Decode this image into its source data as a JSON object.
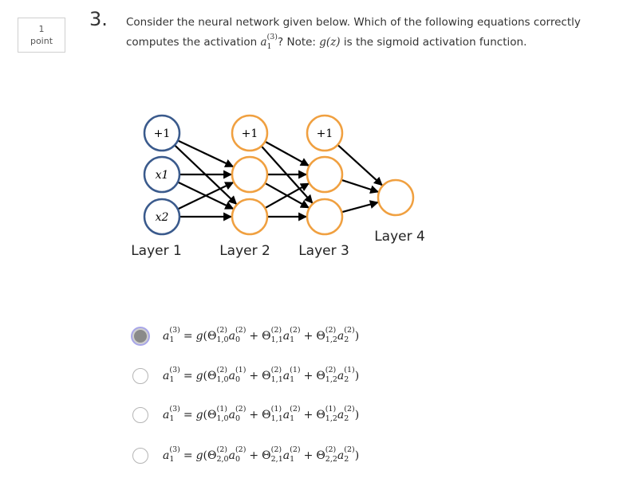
{
  "points": {
    "value": "1",
    "label": "point"
  },
  "question": {
    "number": "3.",
    "text_before": "Consider the neural network given below. Which of the following equations correctly computes the activation ",
    "activation_var": "a",
    "activation_sup": "(3)",
    "activation_sub": "1",
    "text_after": "? Note: ",
    "note_func": "g(z)",
    "note_rest": " is the sigmoid activation function."
  },
  "network": {
    "layers": [
      {
        "label": "Layer 1",
        "nodes": [
          "+1",
          "x1",
          "x2"
        ],
        "color": "#3a5a8c"
      },
      {
        "label": "Layer 2",
        "nodes": [
          "+1",
          "",
          ""
        ],
        "color": "#f0a040"
      },
      {
        "label": "Layer 3",
        "nodes": [
          "+1",
          "",
          ""
        ],
        "color": "#f0a040"
      },
      {
        "label": "Layer 4",
        "nodes": [
          ""
        ],
        "color": "#f0a040"
      }
    ]
  },
  "options": [
    {
      "selected": true,
      "lhs_sup": "(3)",
      "lhs_sub": "1",
      "terms": [
        {
          "theta_sup": "(2)",
          "theta_sub": "1,0",
          "a_sup": "(2)",
          "a_sub": "0"
        },
        {
          "theta_sup": "(2)",
          "theta_sub": "1,1",
          "a_sup": "(2)",
          "a_sub": "1"
        },
        {
          "theta_sup": "(2)",
          "theta_sub": "1,2",
          "a_sup": "(2)",
          "a_sub": "2"
        }
      ]
    },
    {
      "selected": false,
      "lhs_sup": "(3)",
      "lhs_sub": "1",
      "terms": [
        {
          "theta_sup": "(2)",
          "theta_sub": "1,0",
          "a_sup": "(1)",
          "a_sub": "0"
        },
        {
          "theta_sup": "(2)",
          "theta_sub": "1,1",
          "a_sup": "(1)",
          "a_sub": "1"
        },
        {
          "theta_sup": "(2)",
          "theta_sub": "1,2",
          "a_sup": "(1)",
          "a_sub": "2"
        }
      ]
    },
    {
      "selected": false,
      "lhs_sup": "(3)",
      "lhs_sub": "1",
      "terms": [
        {
          "theta_sup": "(1)",
          "theta_sub": "1,0",
          "a_sup": "(2)",
          "a_sub": "0"
        },
        {
          "theta_sup": "(1)",
          "theta_sub": "1,1",
          "a_sup": "(2)",
          "a_sub": "1"
        },
        {
          "theta_sup": "(1)",
          "theta_sub": "1,2",
          "a_sup": "(2)",
          "a_sub": "2"
        }
      ]
    },
    {
      "selected": false,
      "lhs_sup": "(3)",
      "lhs_sub": "1",
      "terms": [
        {
          "theta_sup": "(2)",
          "theta_sub": "2,0",
          "a_sup": "(2)",
          "a_sub": "0"
        },
        {
          "theta_sup": "(2)",
          "theta_sub": "2,1",
          "a_sup": "(2)",
          "a_sub": "1"
        },
        {
          "theta_sup": "(2)",
          "theta_sub": "2,2",
          "a_sup": "(2)",
          "a_sub": "2"
        }
      ]
    }
  ],
  "symbols": {
    "a": "a",
    "g": "g",
    "theta": "Θ",
    "equals": "=",
    "plus": "+",
    "open": "(",
    "close": ")"
  }
}
